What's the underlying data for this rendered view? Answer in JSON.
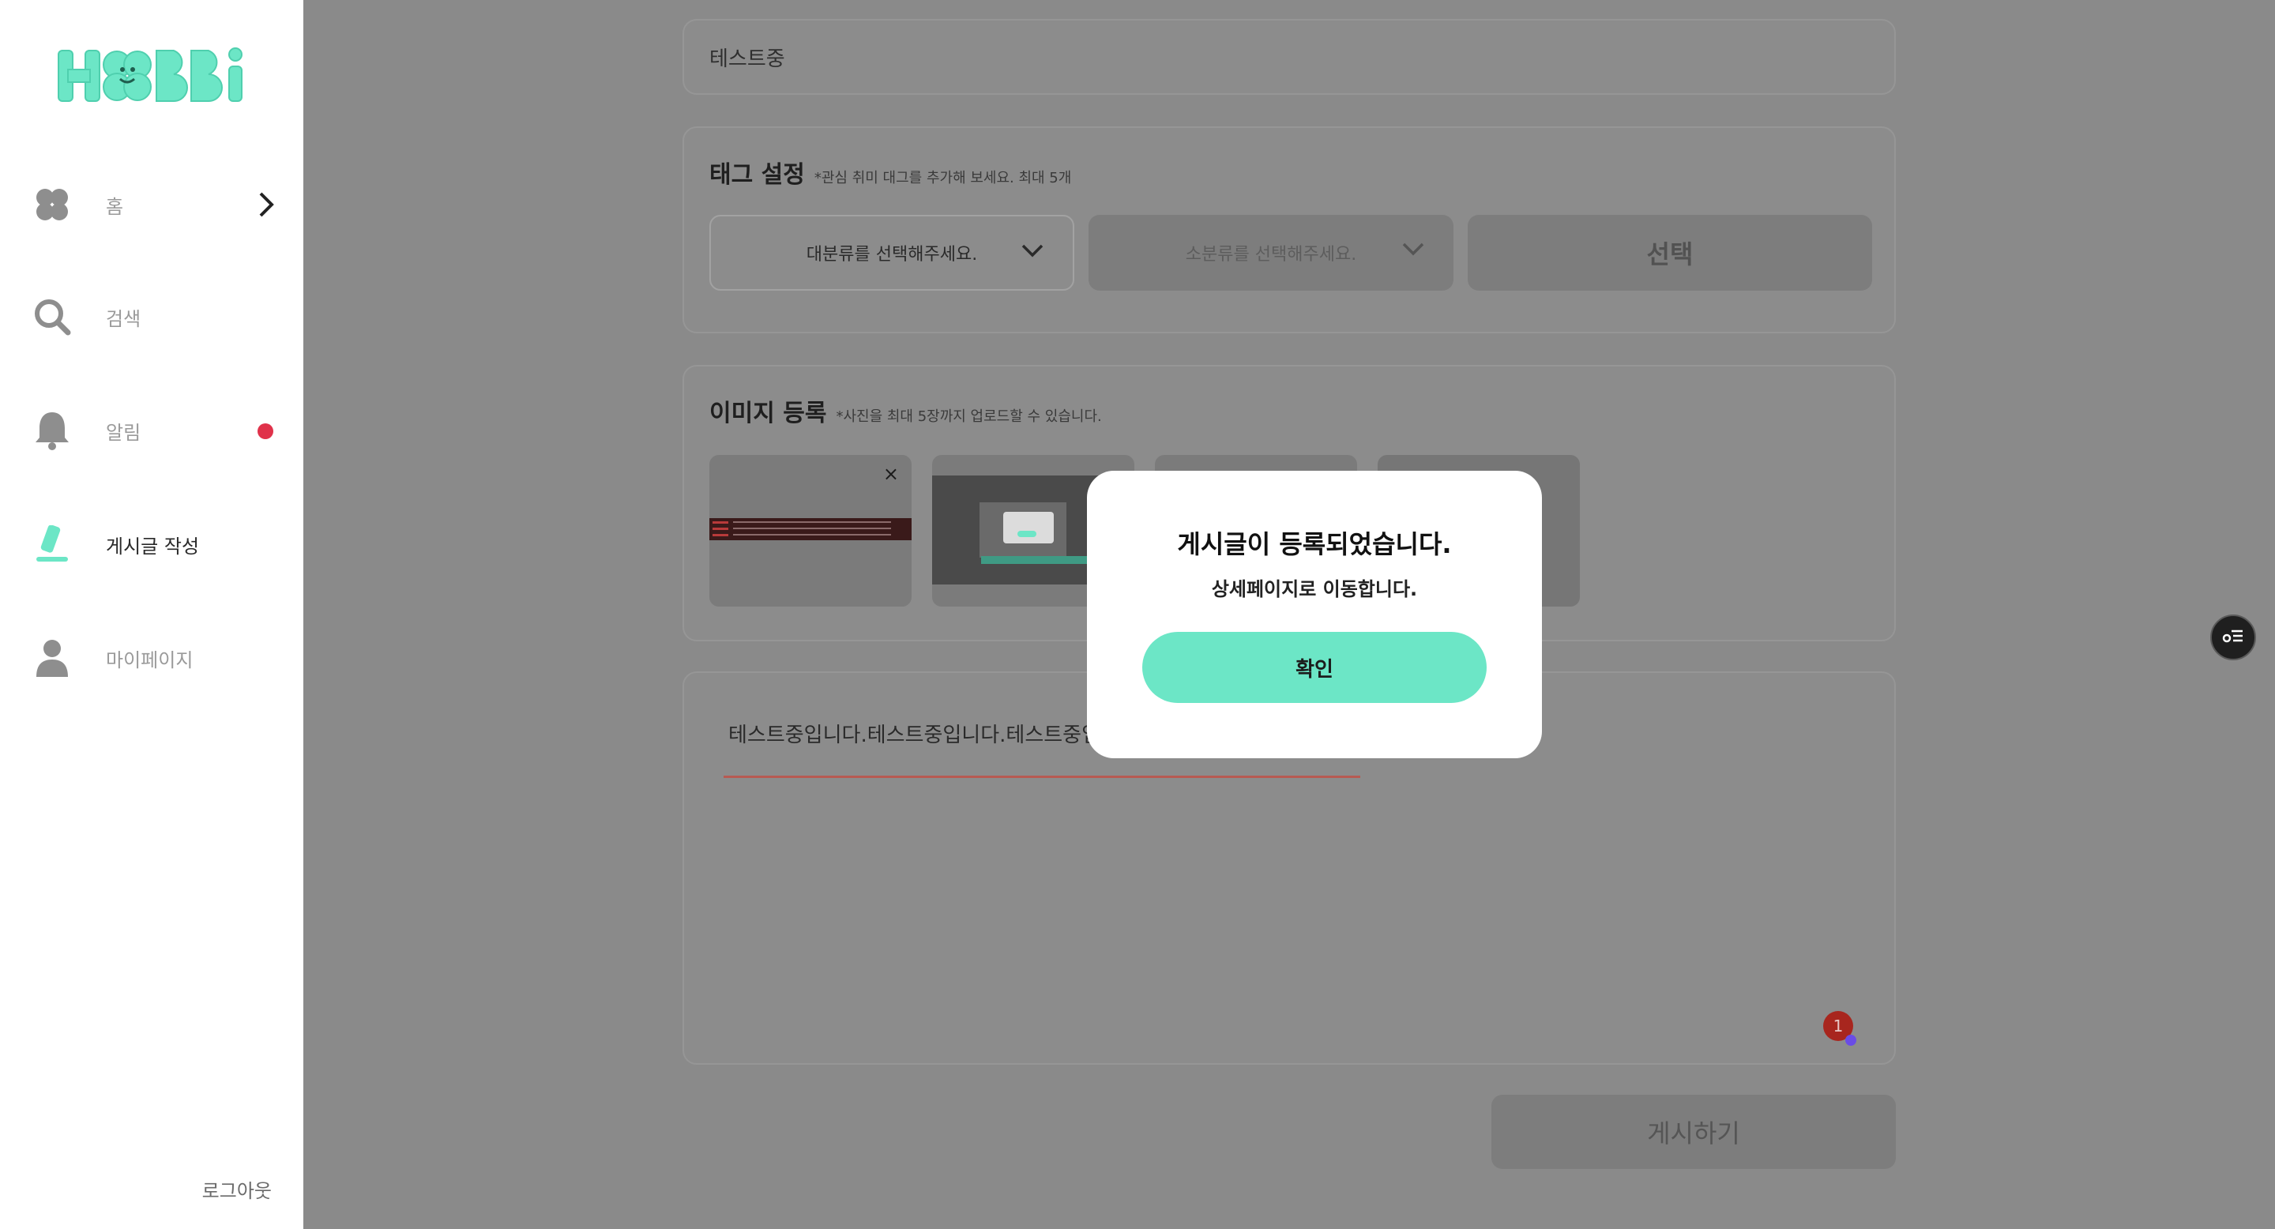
{
  "app": {
    "logo_text": "HOBBi",
    "brand_color": "#6ce6c6"
  },
  "sidebar": {
    "items": [
      {
        "label": "홈",
        "icon": "clover-icon"
      },
      {
        "label": "검색",
        "icon": "search-icon"
      },
      {
        "label": "알림",
        "icon": "bell-icon",
        "has_notification": true
      },
      {
        "label": "게시글 작성",
        "icon": "pen-icon",
        "active": true
      },
      {
        "label": "마이페이지",
        "icon": "user-icon"
      }
    ],
    "logout_label": "로그아웃"
  },
  "post": {
    "title_value": "테스트중",
    "tags": {
      "heading": "태그 설정",
      "hint": "*관심 취미 대그를 추가해 보세요. 최대 5개",
      "major_placeholder": "대분류를 선택해주세요.",
      "minor_placeholder": "소분류를 선택해주세요.",
      "select_button": "선택"
    },
    "images": {
      "heading": "이미지 등록",
      "hint": "*사진을 최대 5장까지 업로드할 수 있습니다.",
      "remove_icon": "close-icon",
      "remove_label": "×"
    },
    "content_value": "테스트중입니다.테스트중입니다.테스트중입니다.",
    "error_count": "1",
    "submit_label": "게시하기"
  },
  "modal": {
    "title": "게시글이 등록되었습니다.",
    "subtitle": "상세페이지로 이동합니다.",
    "confirm_label": "확인"
  }
}
